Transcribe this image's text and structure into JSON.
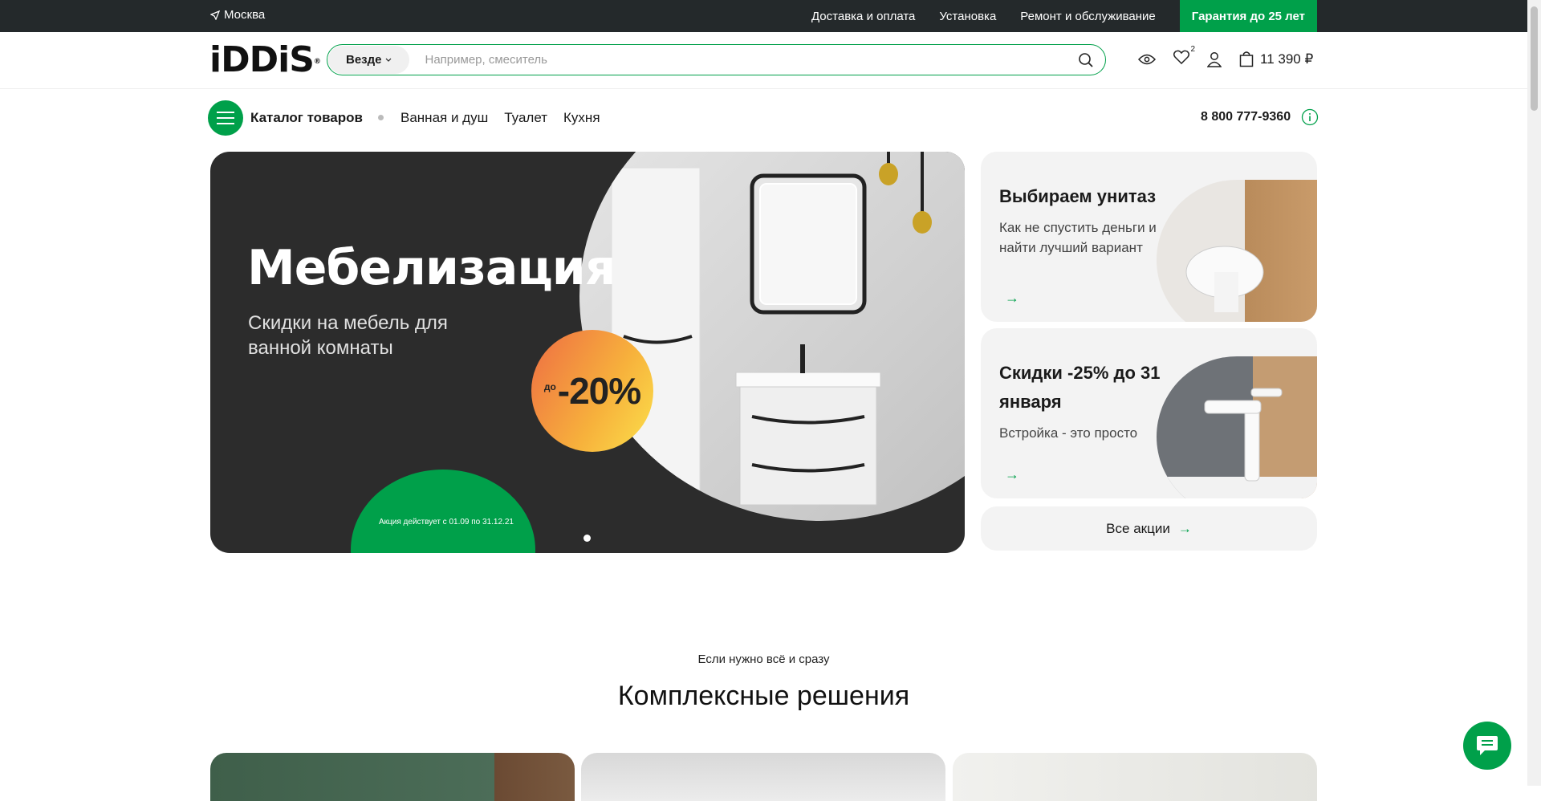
{
  "topbar": {
    "city": "Москва",
    "links": [
      "Доставка и оплата",
      "Установка",
      "Ремонт и обслуживание"
    ],
    "guarantee": "Гарантия до 25 лет"
  },
  "header": {
    "logo": "iDDiS",
    "logo_mark": "®",
    "search_scope": "Везде",
    "search_placeholder": "Например, смеситель",
    "favorites_count": "2",
    "cart_total": "11 390 ₽"
  },
  "nav": {
    "catalog": "Каталог товаров",
    "links": [
      "Ванная и душ",
      "Туалет",
      "Кухня"
    ],
    "phone": "8 800 777-9360"
  },
  "hero": {
    "title": "Мебелизация",
    "subtitle": "Скидки на мебель для ванной комнаты",
    "badge_prefix": "до",
    "badge_value": "-20%",
    "note": "Акция действует с 01.09 по 31.12.21"
  },
  "promos": [
    {
      "title": "Выбираем унитаз",
      "text": "Как не спустить деньги и найти лучший вариант",
      "arrow": "→"
    },
    {
      "title": "Скидки -25% до 31 января",
      "text": "Встройка - это просто",
      "arrow": "→"
    }
  ],
  "all_promos": {
    "label": "Все акции",
    "arrow": "→"
  },
  "section": {
    "subtitle": "Если нужно всё и сразу",
    "title": "Комплексные решения"
  },
  "colors": {
    "brand_green": "#00a04a",
    "topbar": "#24292b",
    "hero_bg": "#2c2c2c"
  }
}
